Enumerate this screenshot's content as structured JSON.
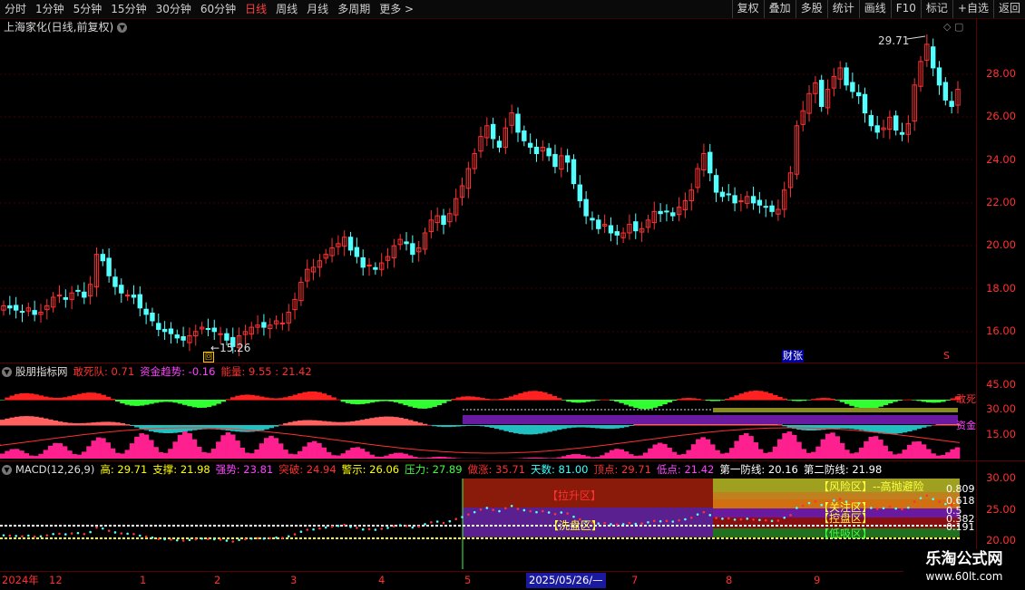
{
  "toolbar": {
    "periods": [
      "分时",
      "1分钟",
      "5分钟",
      "15分钟",
      "30分钟",
      "60分钟",
      "日线",
      "周线",
      "月线",
      "多周期",
      "更多"
    ],
    "active": "日线",
    "right": [
      "复权",
      "叠加",
      "多股",
      "统计",
      "画线",
      "F10",
      "标记",
      "+自选",
      "返回"
    ]
  },
  "title": "上海家化(日线,前复权)",
  "price_axis": [
    "28.00",
    "26.00",
    "24.00",
    "22.00",
    "20.00",
    "18.00",
    "16.00"
  ],
  "price_chart": {
    "high_label": "29.71",
    "low_label": "15.26",
    "event_label": "财张",
    "candles": [
      17.2,
      17.1,
      17.0,
      16.9,
      17.1,
      16.8,
      16.9,
      17.2,
      17.6,
      17.7,
      17.5,
      17.8,
      17.9,
      17.6,
      18.2,
      19.6,
      19.3,
      18.6,
      18.1,
      17.8,
      17.7,
      17.6,
      17.1,
      16.8,
      16.5,
      16.1,
      16.0,
      15.9,
      15.7,
      15.6,
      15.8,
      16.0,
      16.2,
      16.1,
      16.0,
      15.9,
      15.6,
      15.3,
      15.8,
      16.0,
      16.2,
      16.3,
      16.2,
      16.3,
      16.5,
      16.4,
      16.9,
      17.5,
      18.3,
      18.9,
      19.0,
      19.3,
      19.6,
      19.9,
      20.1,
      20.4,
      19.8,
      19.5,
      19.0,
      19.1,
      18.9,
      19.2,
      19.5,
      20.0,
      20.3,
      20.1,
      19.6,
      19.9,
      20.6,
      21.2,
      21.4,
      21.0,
      21.5,
      22.2,
      22.8,
      23.6,
      24.3,
      25.1,
      25.6,
      25.0,
      24.6,
      25.5,
      26.2,
      25.3,
      24.9,
      24.6,
      24.3,
      24.6,
      24.2,
      23.7,
      24.2,
      23.9,
      22.9,
      22.1,
      21.4,
      21.2,
      20.8,
      21.0,
      20.6,
      20.5,
      20.6,
      21.0,
      20.7,
      20.8,
      21.2,
      21.6,
      21.5,
      21.6,
      21.4,
      21.8,
      22.1,
      22.6,
      23.6,
      24.3,
      23.4,
      22.5,
      22.3,
      22.4,
      22.0,
      22.1,
      22.3,
      22.0,
      21.9,
      21.8,
      21.6,
      21.7,
      22.6,
      23.4,
      25.6,
      26.3,
      27.1,
      27.6,
      26.5,
      27.3,
      27.9,
      28.3,
      27.5,
      27.2,
      27.0,
      26.2,
      25.6,
      25.3,
      25.5,
      26.0,
      25.4,
      25.2,
      25.7,
      27.5,
      28.6,
      29.4,
      28.3,
      27.5,
      26.8,
      26.5,
      27.3
    ]
  },
  "ind1": {
    "name": "股朋指标网",
    "items": [
      {
        "label": "敢死队: 0.71",
        "color": "#ff3030"
      },
      {
        "label": "资金趋势: -0.16",
        "color": "#ff40ff"
      },
      {
        "label": "能量: 9.55 : 21.42",
        "color": "#ff3030"
      }
    ],
    "axis": [
      "45.00",
      "30.00",
      "15.00"
    ],
    "right_tags": [
      "敢死",
      "资金"
    ]
  },
  "ind2": {
    "name": "MACD(12,26,9)",
    "items": [
      {
        "label": "高: 29.71",
        "color": "#ffff00"
      },
      {
        "label": "支撑: 21.98",
        "color": "#ffff00"
      },
      {
        "label": "强势: 23.81",
        "color": "#ff40ff"
      },
      {
        "label": "突破: 24.94",
        "color": "#ff3030"
      },
      {
        "label": "警示: 26.06",
        "color": "#ffff00"
      },
      {
        "label": "压力: 27.89",
        "color": "#40ff40"
      },
      {
        "label": "做涨: 35.71",
        "color": "#ff3030"
      },
      {
        "label": "天数: 81.00",
        "color": "#40ffff"
      },
      {
        "label": "顶点: 29.71",
        "color": "#ff3030"
      },
      {
        "label": "低点: 21.42",
        "color": "#ff40ff"
      },
      {
        "label": "第一防线: 20.16",
        "color": "#ffffff"
      },
      {
        "label": "第二防线: 21.98",
        "color": "#ffffff"
      }
    ],
    "axis": [
      "30.00",
      "25.00",
      "20.00"
    ],
    "zones": {
      "lift": "【拉升区】",
      "wash": "【洗盘区】",
      "risk": "【风险区】--高抛避险",
      "attention": "【关注区】",
      "control": "【控盘区】",
      "buy": "【低吸区】"
    },
    "fib": [
      "0.809",
      "0.618",
      "0.5",
      "0.382",
      "0.191"
    ]
  },
  "dates": {
    "year": "2024年",
    "months": [
      "12",
      "1",
      "2",
      "3",
      "4",
      "5",
      "7",
      "8",
      "9"
    ],
    "selected": "2025/05/26/—"
  },
  "watermark": {
    "line1": "乐淘公式网",
    "line2": "www.60lt.com"
  }
}
